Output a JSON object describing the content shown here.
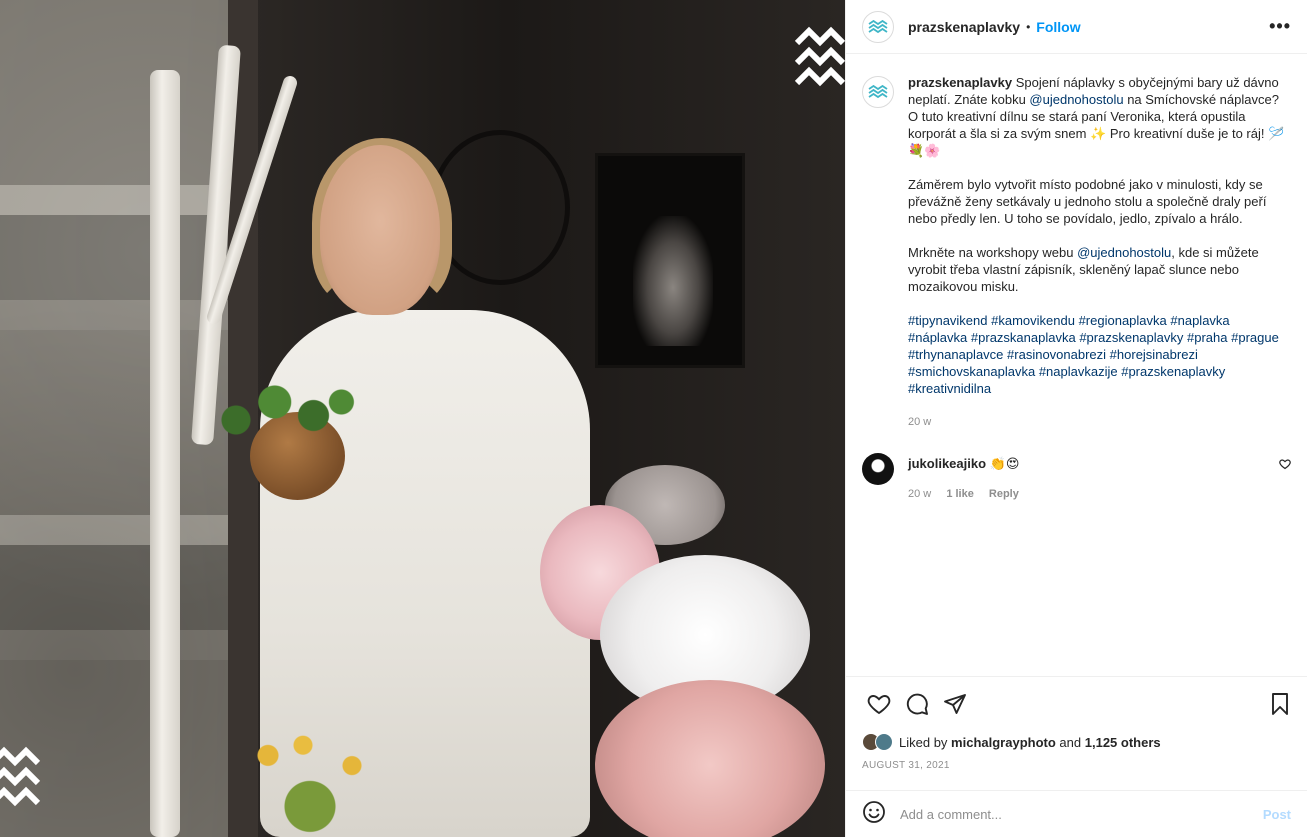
{
  "account": {
    "username": "prazskenaplavky",
    "separator": "•",
    "follow_label": "Follow",
    "more_label": "•••"
  },
  "caption": {
    "username": "prazskenaplavky",
    "p1_a": "Spojení náplavky s obyčejnými bary už dávno neplatí. Znáte kobku ",
    "p1_mention": "@ujednohostolu",
    "p1_b": " na Smíchovské náplavce? O tuto kreativní dílnu se stará paní Veronika, která opustila korporát a šla si za svým snem ✨ Pro kreativní duše je to ráj! 🪡💐🌸",
    "p2": "Záměrem bylo vytvořit místo podobné jako v minulosti, kdy se převážně ženy setkávaly u jednoho stolu a společně draly peří nebo předly len. U toho se povídalo, jedlo, zpívalo a hrálo.",
    "p3_a": "Mrkněte na workshopy webu ",
    "p3_mention": "@ujednohostolu",
    "p3_b": ", kde si můžete vyrobit třeba vlastní zápisník, skleněný lapač slunce nebo mozaikovou misku.",
    "hashtags": [
      "#tipynavikend",
      "#kamovikendu",
      "#regionaplavka",
      "#naplavka",
      "#náplavka",
      "#prazskanaplavka",
      "#prazskenaplavky",
      "#praha",
      "#prague",
      "#trhynanaplavce",
      "#rasinovonabrezi",
      "#horejsinabrezi",
      "#smichovskanaplavka",
      "#naplavkazije",
      "#prazskenaplavky",
      "#kreativnidilna"
    ],
    "time": "20 w"
  },
  "comment": {
    "username": "jukolikeajiko",
    "text": "👏😍",
    "time": "20 w",
    "likes": "1 like",
    "reply_label": "Reply"
  },
  "likes": {
    "prefix": "Liked by",
    "user": "michalgrayphoto",
    "conj": "and",
    "others": "1,125 others"
  },
  "date": "AUGUST 31, 2021",
  "add_comment": {
    "placeholder": "Add a comment...",
    "post_label": "Post"
  },
  "icons": {
    "logo": "waves-logo-icon",
    "like": "heart-icon",
    "comment": "comment-bubble-icon",
    "share": "paper-plane-icon",
    "save": "bookmark-icon",
    "emoji": "smiley-icon",
    "more": "ellipsis-icon"
  },
  "colors": {
    "link": "#0095f6",
    "mention": "#00376b",
    "muted": "#8e8e8e",
    "post_disabled": "#b3dbff",
    "brand": "#3fb6c7"
  }
}
